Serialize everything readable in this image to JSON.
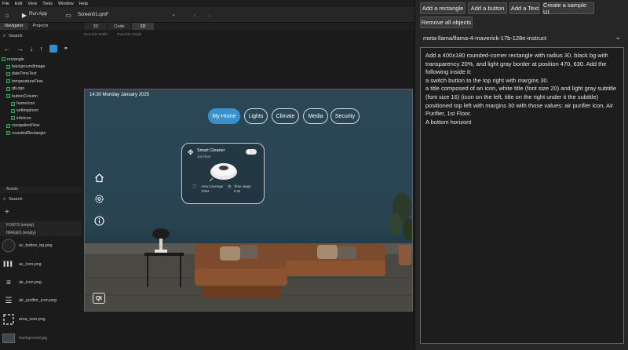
{
  "menubar": [
    "File",
    "Edit",
    "View",
    "Tools",
    "Window",
    "Help"
  ],
  "toolbar": {
    "run_label": "Run App",
    "current_file": "Screen01.qml*"
  },
  "left_tabs": [
    "Navigator",
    "Projects"
  ],
  "navigator": {
    "search_placeholder": "Search",
    "tree": [
      {
        "label": "rectangle",
        "depth": 0
      },
      {
        "label": "backgroundImage",
        "depth": 1
      },
      {
        "label": "dateTimeText",
        "depth": 1
      },
      {
        "label": "temperatureFlow",
        "depth": 1
      },
      {
        "label": "qtLogo",
        "depth": 1
      },
      {
        "label": "buttonColumn",
        "depth": 1
      },
      {
        "label": "homeIcon",
        "depth": 2
      },
      {
        "label": "settingsIcon",
        "depth": 2
      },
      {
        "label": "infoIcon",
        "depth": 2
      },
      {
        "label": "navigationFlow",
        "depth": 1
      },
      {
        "label": "roundedRectangle",
        "depth": 1
      }
    ]
  },
  "assets": {
    "header": "Assets",
    "search_placeholder": "Search",
    "fonts_section": "FONTS (empty)",
    "images_section": "IMAGES (empty)",
    "items": [
      "ac_button_bg.png",
      "ac_icon.png",
      "air_icon.png",
      "air_purifier_icon.png",
      "area_icon.png",
      "background.jpg"
    ]
  },
  "editor_tabs": [
    "3D",
    "Code",
    "2D"
  ],
  "overlay_labels": [
    "Override Width",
    "Override Height"
  ],
  "canvas": {
    "datetime": "14:30 Monday January 2025",
    "nav_pills": [
      "My Home",
      "Lights",
      "Climate",
      "Media",
      "Security"
    ],
    "card": {
      "title": "Smart Cleaner",
      "subtitle": "1st Floor",
      "stat1_label": "Area Coverage",
      "stat1_value": "70m2",
      "stat2_label": "Time usage",
      "stat2_value": "0:42"
    },
    "qt_badge": "Qt"
  },
  "right_panel": {
    "buttons": [
      "Add a rectangle",
      "Add a button",
      "Add a Text",
      "Create a sample UI",
      "Remove all objects"
    ],
    "model": "meta-llama/llama-4-maverick-17b-128e-instruct",
    "prompt": "Add a 400x180 rounded-corner rectangle with radius 30, black bg with transparency 20%, and light gray border at position 470, 630. Add the following inside it:\na switch button to the top right with margins 30.\na title composed of an icon, white title (font size 20) and light gray subtitle (font size 16) (icon on the left, title on the right under it the subtitle) positioned top left with margins 30 with those values: air purifier icon, Air Purifier, 1st Floor.\nA bottom horizont"
  },
  "colors": {
    "accent_blue": "#3a90cc",
    "canvas_border": "#8a3f8a",
    "tree_icon_green": "#3c9c5a"
  }
}
